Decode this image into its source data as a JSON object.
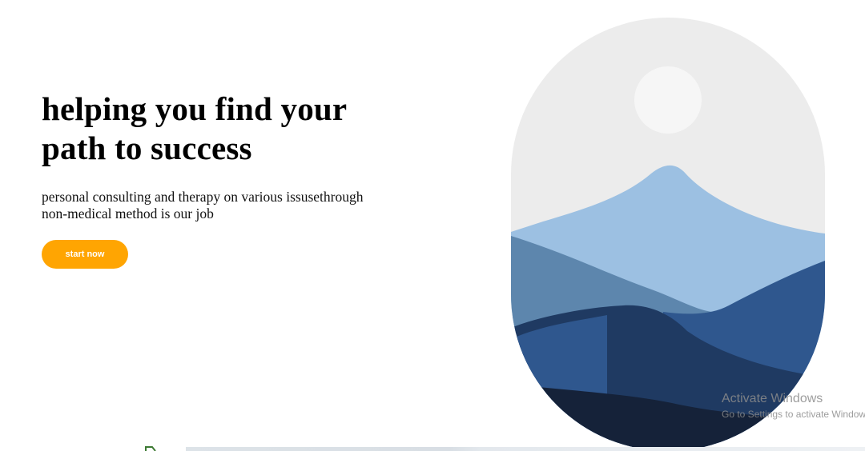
{
  "hero": {
    "headline_line1": "helping you find your",
    "headline_line2": "path to success",
    "subtext_line1": "personal consulting and therapy on various issusethrough",
    "subtext_line2": "non-medical method is our job",
    "cta_label": "start now"
  },
  "illustration": {
    "icon": "mountain-landscape-illustration",
    "colors": {
      "sky": "#ececec",
      "sun": "#f6f6f6",
      "mountain_light": "#9cc0e2",
      "mountain_mid": "#5d86ad",
      "mountain_blue": "#2f578e",
      "mountain_dark": "#1f3a62",
      "mountain_darkest": "#152239"
    }
  },
  "os_overlay": {
    "watermark_title": "Activate Windows",
    "watermark_subtitle": "Go to Settings to activate Windows."
  },
  "colors": {
    "accent": "#ffa502",
    "text": "#000000",
    "background": "#ffffff"
  }
}
